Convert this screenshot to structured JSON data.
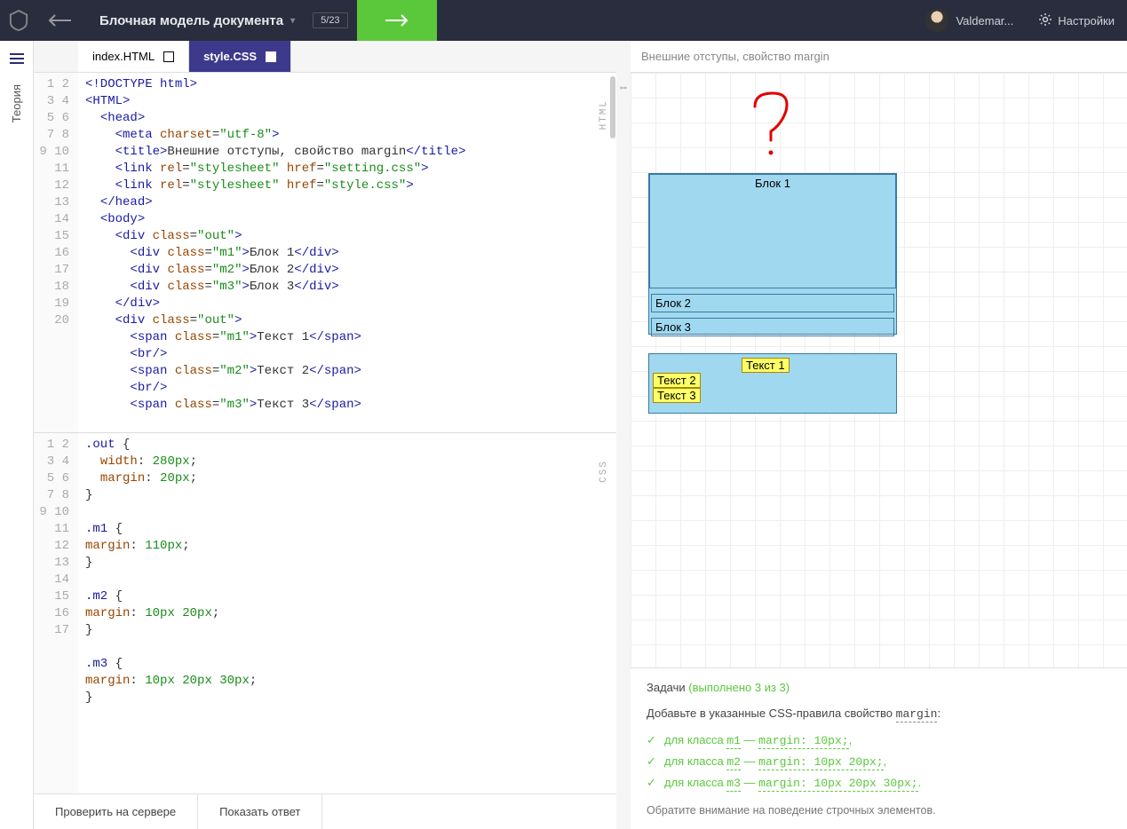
{
  "topbar": {
    "lesson_title": "Блочная модель документа",
    "step_counter": "5/23",
    "username": "Valdemar...",
    "settings_label": "Настройки"
  },
  "sidebar": {
    "theory_label": "Теория"
  },
  "tabs": {
    "html": "index.HTML",
    "css": "style.CSS"
  },
  "code_html": {
    "lines": [
      "1",
      "2",
      "3",
      "4",
      "5",
      "6",
      "7",
      "8",
      "9",
      "10",
      "11",
      "12",
      "13",
      "14",
      "15",
      "16",
      "17",
      "18",
      "19",
      "20"
    ]
  },
  "code_css": {
    "lines": [
      "1",
      "2",
      "3",
      "4",
      "5",
      "6",
      "7",
      "8",
      "9",
      "10",
      "11",
      "12",
      "13",
      "14",
      "15",
      "16",
      "17"
    ]
  },
  "footer": {
    "check": "Проверить на сервере",
    "show_answer": "Показать ответ"
  },
  "preview": {
    "title": "Внешние отступы, свойство margin",
    "html_label": "HTML",
    "css_label": "CSS",
    "block1": "Блок 1",
    "block2": "Блок 2",
    "block3": "Блок 3",
    "text1": "Текст 1",
    "text2": "Текст 2",
    "text3": "Текст 3"
  },
  "tasks": {
    "title": "Задачи",
    "done": "(выполнено 3 из 3)",
    "description_pre": "Добавьте в указанные CSS-правила свойство ",
    "description_code": "margin",
    "description_post": ":",
    "items": [
      {
        "pre": "для класса ",
        "cls": "m1",
        "sep": " — ",
        "rule": "margin: 10px;",
        "post": ","
      },
      {
        "pre": "для класса ",
        "cls": "m2",
        "sep": " — ",
        "rule": "margin: 10px 20px;",
        "post": ","
      },
      {
        "pre": "для класса ",
        "cls": "m3",
        "sep": " — ",
        "rule": "margin: 10px 20px 30px;",
        "post": "."
      }
    ],
    "note": "Обратите внимание на поведение строчных элементов."
  }
}
